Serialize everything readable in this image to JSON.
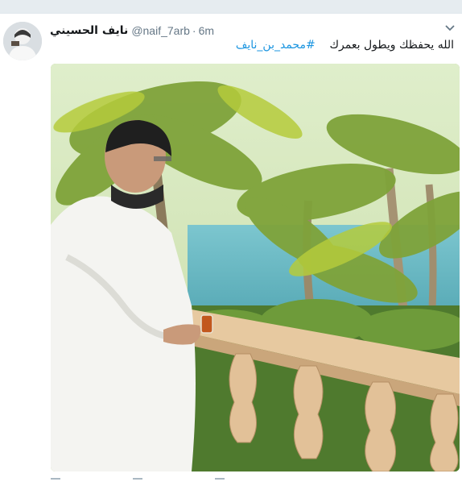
{
  "tweet": {
    "display_name": "نايف الحسيني",
    "handle": "@naif_7arb",
    "separator": "·",
    "time": "6m",
    "text_prefix": "الله يحفظك ويطول بعمرك",
    "hashtag": "#محمد_بن_نايف"
  },
  "icons": {
    "caret": "chevron-down-icon",
    "reply": "reply-icon",
    "retweet": "retweet-icon",
    "like": "heart-icon"
  },
  "colors": {
    "hashtag": "#1b95e0",
    "name": "#14171a",
    "meta": "#657786"
  }
}
